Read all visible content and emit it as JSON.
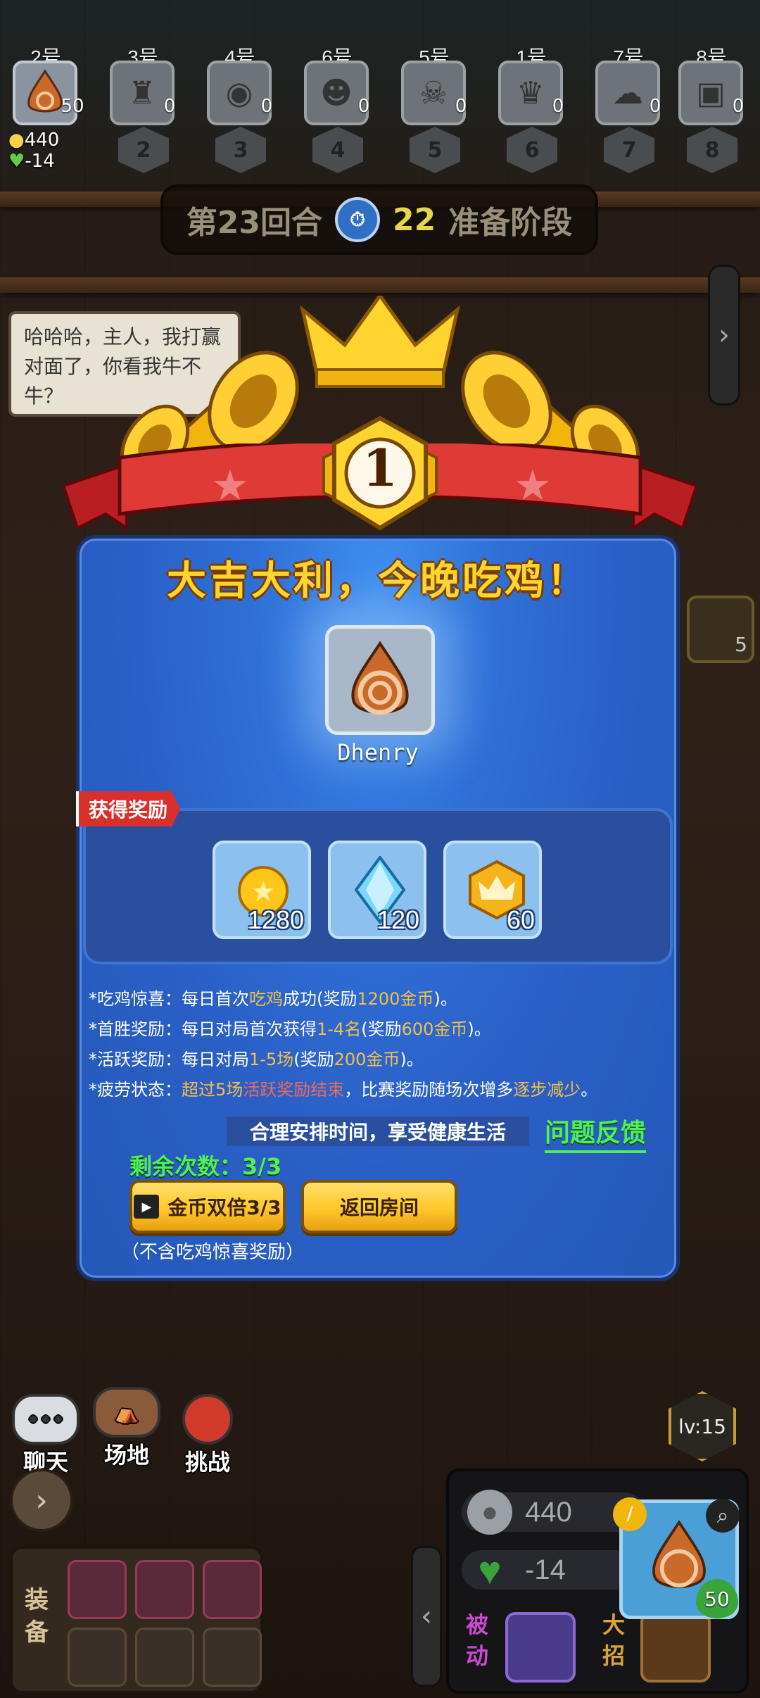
{
  "players": [
    {
      "label": "2号",
      "hp": "50",
      "rank": "",
      "active": true
    },
    {
      "label": "3号",
      "hp": "0",
      "rank": "2"
    },
    {
      "label": "4号",
      "hp": "0",
      "rank": "3"
    },
    {
      "label": "6号",
      "hp": "0",
      "rank": "4"
    },
    {
      "label": "5号",
      "hp": "0",
      "rank": "5"
    },
    {
      "label": "1号",
      "hp": "0",
      "rank": "6"
    },
    {
      "label": "7号",
      "hp": "0",
      "rank": "7"
    },
    {
      "label": "8号",
      "hp": "0",
      "rank": "8"
    }
  ],
  "my_stats": {
    "coins": "440",
    "hp": "-14"
  },
  "round": {
    "round_label": "第23回合",
    "seconds": "22",
    "phase": "准备阶段"
  },
  "chat_bubble": "哈哈哈，主人，我打赢对面了，你看我牛不牛？",
  "side": {
    "sword_count": "5"
  },
  "result": {
    "rank": "1",
    "headline": "大吉大利，今晚吃鸡！",
    "winner_name": "Dhenry"
  },
  "rewards": {
    "tag": "获得奖励",
    "items": [
      {
        "icon": "gold-coin-icon",
        "amount": "1280"
      },
      {
        "icon": "diamond-icon",
        "amount": "120"
      },
      {
        "icon": "crown-badge-icon",
        "amount": "60"
      }
    ]
  },
  "rules": [
    {
      "prefix": "*吃鸡惊喜：每日首次",
      "hl": "吃鸡",
      "mid": "成功(奖励",
      "hl2": "1200金币",
      "suffix": ")。"
    },
    {
      "prefix": "*首胜奖励：每日对局首次获得",
      "hl": "1-4名",
      "mid": "(奖励",
      "hl2": "600金币",
      "suffix": ")。"
    },
    {
      "prefix": "*活跃奖励：每日对局",
      "hl": "1-5场",
      "mid": "(奖励",
      "hl2": "200金币",
      "suffix": ")。"
    },
    {
      "prefix": "*疲劳状态：",
      "hl": "超过5场",
      "mid": "活跃奖励结束",
      "hl2": "逐步减少",
      "suffix": "。",
      "mid2": "，比赛奖励随场次增多"
    }
  ],
  "slogan": "合理安排时间，享受健康生活",
  "feedback": "问题反馈",
  "remaining": "剩余次数：3/3",
  "buttons": {
    "double": "金币双倍3/3",
    "back": "返回房间"
  },
  "note": "（不含吃鸡惊喜奖励）",
  "hud": {
    "chat": "聊天",
    "venue": "场地",
    "challenge": "挑战",
    "equip_label": "装备",
    "coins": "440",
    "hp": "-14",
    "hero_hp": "50",
    "passive": "被动",
    "ultimate": "大招",
    "level": "lv:15"
  },
  "colors": {
    "panel": "#2e6fd6",
    "gold": "#ffd42e",
    "green": "#4ef05a",
    "ribbon": "#d9302c"
  }
}
